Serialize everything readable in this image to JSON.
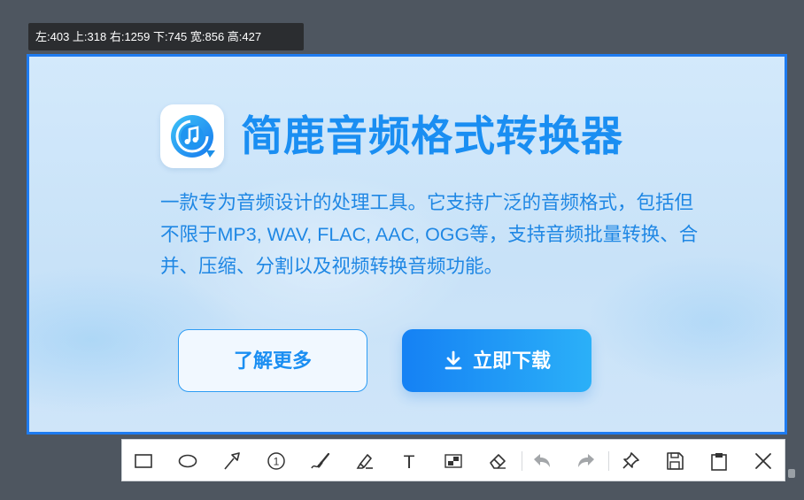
{
  "selection_info": {
    "text": "左:403 上:318 右:1259 下:745 宽:856 高:427"
  },
  "promo": {
    "app_icon": "music-note-refresh-icon",
    "title": "简鹿音频格式转换器",
    "description": "一款专为音频设计的处理工具。它支持广泛的音频格式，包括但不限于MP3, WAV, FLAC, AAC, OGG等，支持音频批量转换、合并、压缩、分割以及视频转换音频功能。",
    "learn_more_label": "了解更多",
    "download_label": "立即下载",
    "download_icon": "download-icon",
    "colors": {
      "accent": "#1a8ef2",
      "gradient_start": "#1581f4",
      "gradient_end": "#2bb0f8",
      "selection_border": "#1e7bf0"
    }
  },
  "toolbar": {
    "tools": [
      {
        "name": "rectangle",
        "icon": "rectangle-icon"
      },
      {
        "name": "ellipse",
        "icon": "ellipse-icon"
      },
      {
        "name": "arrow",
        "icon": "arrow-icon"
      },
      {
        "name": "number-marker",
        "icon": "circled-number-icon"
      },
      {
        "name": "brush",
        "icon": "brush-icon"
      },
      {
        "name": "highlighter",
        "icon": "highlighter-icon"
      },
      {
        "name": "text",
        "icon": "text-icon"
      },
      {
        "name": "mosaic",
        "icon": "mosaic-icon"
      },
      {
        "name": "eraser",
        "icon": "eraser-icon"
      },
      {
        "name": "undo",
        "icon": "undo-icon"
      },
      {
        "name": "redo",
        "icon": "redo-icon"
      },
      {
        "name": "pin",
        "icon": "pin-icon"
      },
      {
        "name": "save",
        "icon": "save-icon"
      },
      {
        "name": "copy",
        "icon": "clipboard-icon"
      },
      {
        "name": "close",
        "icon": "close-icon"
      }
    ],
    "number_marker_glyph": "1",
    "text_tool_glyph": "T"
  }
}
